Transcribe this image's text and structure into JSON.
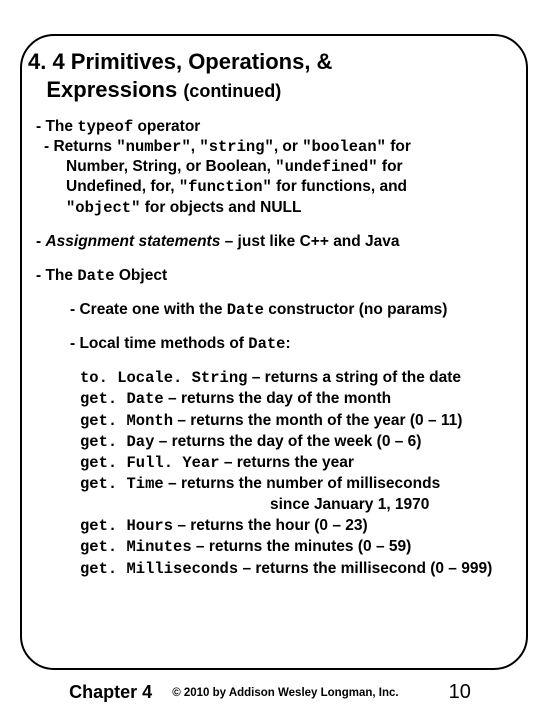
{
  "title": {
    "line1": "4. 4 Primitives, Operations, &",
    "line2_a": "Expressions",
    "line2_b": "(continued)"
  },
  "typeof": {
    "lead_a": "- The ",
    "lead_code": "typeof",
    "lead_b": " operator",
    "ret_a": "- Returns ",
    "ret_c1": "\"number\"",
    "ret_b": ", ",
    "ret_c2": "\"string\"",
    "ret_c": ", or ",
    "ret_c3": "\"boolean\"",
    "ret_d": " for",
    "l2_a": "Number, String, or Boolean, ",
    "l2_c1": "\"undefined\"",
    "l2_b": " for",
    "l3_a": "Undefined, for, ",
    "l3_c1": "\"function\"",
    "l3_b": " for functions, and",
    "l4_c1": "\"object\"",
    "l4_a": " for objects and NULL"
  },
  "assign": {
    "a": "- ",
    "i": "Assignment statements",
    "b": " – just like C++ and Java"
  },
  "date_hdr": {
    "a": "- The ",
    "code": "Date",
    "b": " Object"
  },
  "date_create": {
    "a": "- Create one with the ",
    "code": "Date",
    "b": " constructor (no params)"
  },
  "date_methods_hdr": {
    "a": "- Local time methods of ",
    "code": "Date",
    "b": ":"
  },
  "methods": {
    "m1_code": "to. Locale. String",
    "m1_txt": " – returns a string of the date",
    "m2_code": "get. Date",
    "m2_txt": " – returns the day of the month",
    "m3_code": "get. Month",
    "m3_txt": " – returns the month of the year (0 – 11)",
    "m4_code": "get. Day",
    "m4_txt": " – returns the day of the week (0 – 6)",
    "m5_code": "get. Full. Year",
    "m5_txt": " – returns the year",
    "m6_code": "get. Time",
    "m6_txt": " – returns the number of milliseconds",
    "m6_since": "since January 1, 1970",
    "m7_code": "get. Hours",
    "m7_txt": " – returns the hour (0 – 23)",
    "m8_code": "get. Minutes",
    "m8_txt": " – returns the minutes (0 – 59)",
    "m9_code": "get. Milliseconds",
    "m9_txt": " – returns the millisecond (0 – 999)"
  },
  "footer": {
    "chapter": "Chapter 4",
    "copy": "© 2010 by Addison Wesley Longman, Inc.",
    "page": "10"
  }
}
